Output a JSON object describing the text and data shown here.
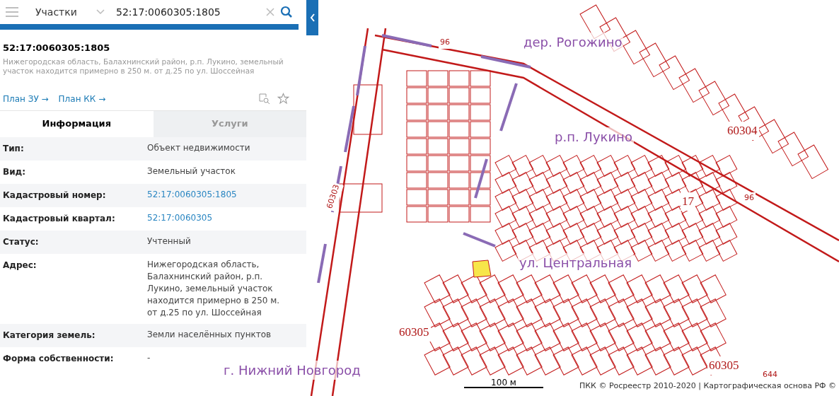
{
  "search": {
    "category": "Участки",
    "query": "52:17:0060305:1805"
  },
  "object": {
    "title": "52:17:0060305:1805",
    "address": "Нижегородская область, Балахнинский район, р.п. Лукино, земельный участок находится примерно в 250 м. от д.25 по ул. Шоссейная"
  },
  "links": [
    "План ЗУ →",
    "План КК →"
  ],
  "tabs": [
    {
      "label": "Информация",
      "selected": true
    },
    {
      "label": "Услуги",
      "selected": false
    }
  ],
  "info_rows": [
    {
      "label": "Тип:",
      "value": "Объект недвижимости",
      "kind": "text"
    },
    {
      "label": "Вид:",
      "value": "Земельный участок",
      "kind": "text"
    },
    {
      "label": "Кадастровый номер:",
      "value": "52:17:0060305:1805",
      "kind": "link"
    },
    {
      "label": "Кадастровый квартал:",
      "value": "52:17:0060305",
      "kind": "link"
    },
    {
      "label": "Статус:",
      "value": "Учтенный",
      "kind": "text"
    },
    {
      "label": "Адрес:",
      "value": "Нижегородская область, Балахнинский район, р.п. Лукино, земельный участок находится примерно в 250 м. от д.25 по ул. Шоссейная",
      "kind": "text"
    },
    {
      "label": "Категория земель:",
      "value": "Земли населённых пунктов",
      "kind": "text"
    },
    {
      "label": "Форма собственности:",
      "value": "-",
      "kind": "text"
    }
  ],
  "map": {
    "labels": [
      {
        "text": "дер. Рогожино",
        "kind": "place"
      },
      {
        "text": "р.п. Лукино",
        "kind": "place"
      },
      {
        "text": "ул. Центральная",
        "kind": "place"
      },
      {
        "text": "г. Нижний Новгород",
        "kind": "place"
      },
      {
        "text": "17",
        "kind": "quarter"
      },
      {
        "text": "60304",
        "kind": "quarter"
      },
      {
        "text": "60303",
        "kind": "road"
      },
      {
        "text": "60305",
        "kind": "quarter"
      },
      {
        "text": "60305",
        "kind": "quarter"
      },
      {
        "text": "96",
        "kind": "road"
      },
      {
        "text": "96",
        "kind": "road"
      },
      {
        "text": "644",
        "kind": "road"
      }
    ],
    "scale": "100 м",
    "attribution": "ПКК © Росреестр 2010-2020 | Картографическая основа РФ ©"
  }
}
